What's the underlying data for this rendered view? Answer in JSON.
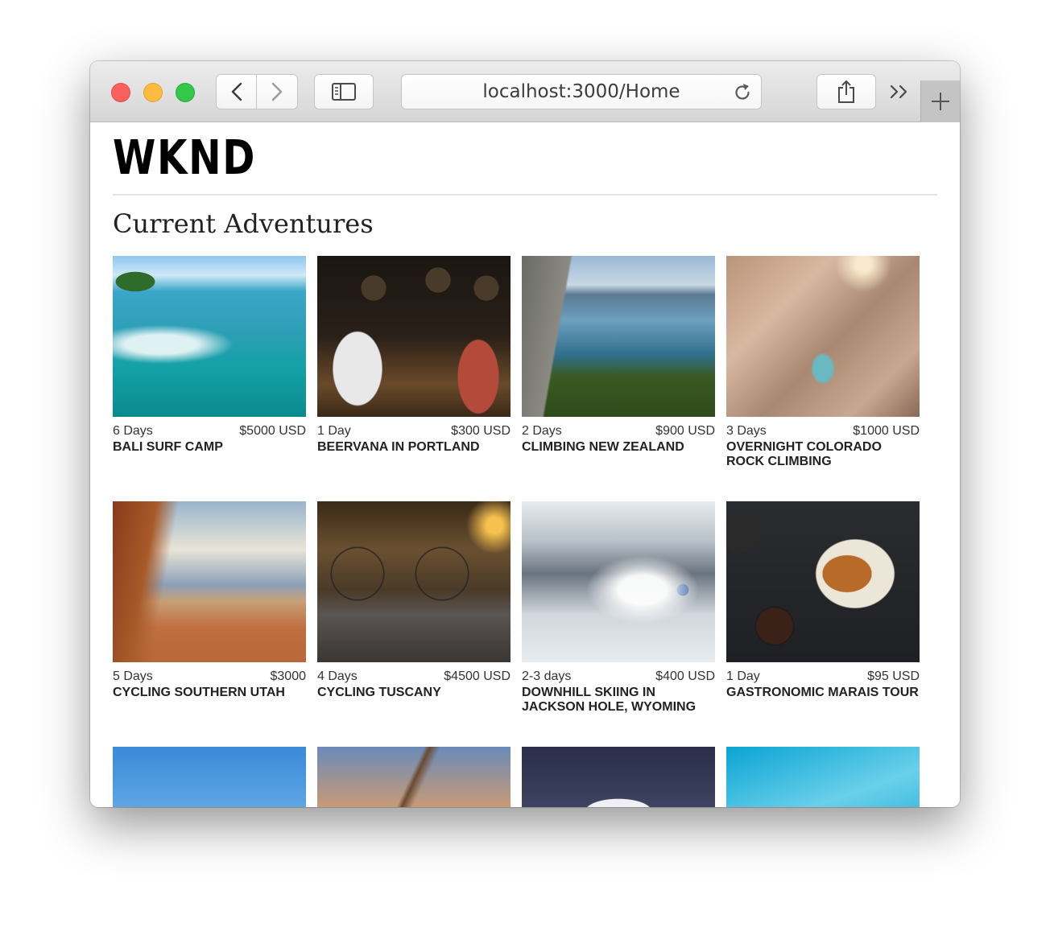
{
  "browser": {
    "url": "localhost:3000/Home"
  },
  "site": {
    "logo": "WKND",
    "section_title": "Current Adventures"
  },
  "adventures": [
    {
      "duration": "6 Days",
      "price": "$5000 USD",
      "title": "BALI SURF CAMP"
    },
    {
      "duration": "1 Day",
      "price": "$300 USD",
      "title": "BEERVANA IN PORTLAND"
    },
    {
      "duration": "2 Days",
      "price": "$900 USD",
      "title": "CLIMBING NEW ZEALAND"
    },
    {
      "duration": "3 Days",
      "price": "$1000 USD",
      "title": "OVERNIGHT COLORADO ROCK CLIMBING"
    },
    {
      "duration": "5 Days",
      "price": "$3000",
      "title": "CYCLING SOUTHERN UTAH"
    },
    {
      "duration": "4 Days",
      "price": "$4500 USD",
      "title": "CYCLING TUSCANY"
    },
    {
      "duration": "2-3 days",
      "price": "$400 USD",
      "title": "DOWNHILL SKIING IN JACKSON HOLE, WYOMING"
    },
    {
      "duration": "1 Day",
      "price": "$95 USD",
      "title": "GASTRONOMIC MARAIS TOUR"
    }
  ]
}
